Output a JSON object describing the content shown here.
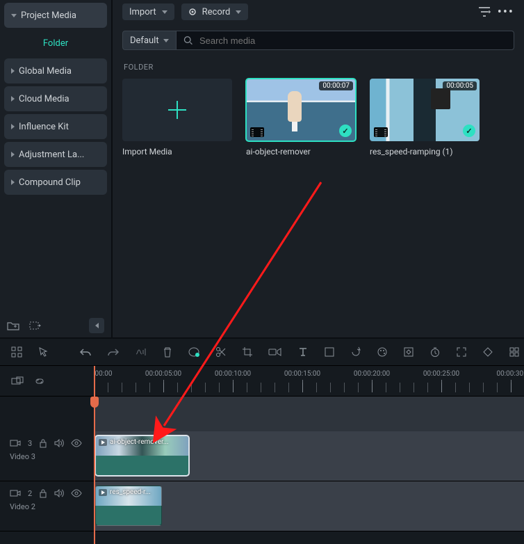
{
  "sidebar": {
    "project_media": "Project Media",
    "folder": "Folder",
    "items": [
      {
        "label": "Global Media"
      },
      {
        "label": "Cloud Media"
      },
      {
        "label": "Influence Kit"
      },
      {
        "label": "Adjustment La..."
      },
      {
        "label": "Compound Clip"
      }
    ]
  },
  "topbar": {
    "import": "Import",
    "record": "Record"
  },
  "search": {
    "default": "Default",
    "placeholder": "Search media"
  },
  "section_label": "FOLDER",
  "cards": {
    "import_media": "Import Media",
    "clip1": {
      "name": "ai-object-remover",
      "duration": "00:00:07"
    },
    "clip2": {
      "name": "res_speed-ramping (1)",
      "duration": "00:00:05"
    }
  },
  "ruler": {
    "t0": "00:00",
    "t5": "00:00:05:00",
    "t10": "00:00:10:00",
    "t15": "00:00:15:00",
    "t20": "00:00:20:00",
    "t25": "00:00:25:00",
    "t30": "00:00:30:"
  },
  "tracks": {
    "v3": {
      "num": "3",
      "name": "Video 3",
      "clip": "ai-object-remover..."
    },
    "v2": {
      "num": "2",
      "name": "Video 2",
      "clip": "res_speed-r..."
    }
  }
}
